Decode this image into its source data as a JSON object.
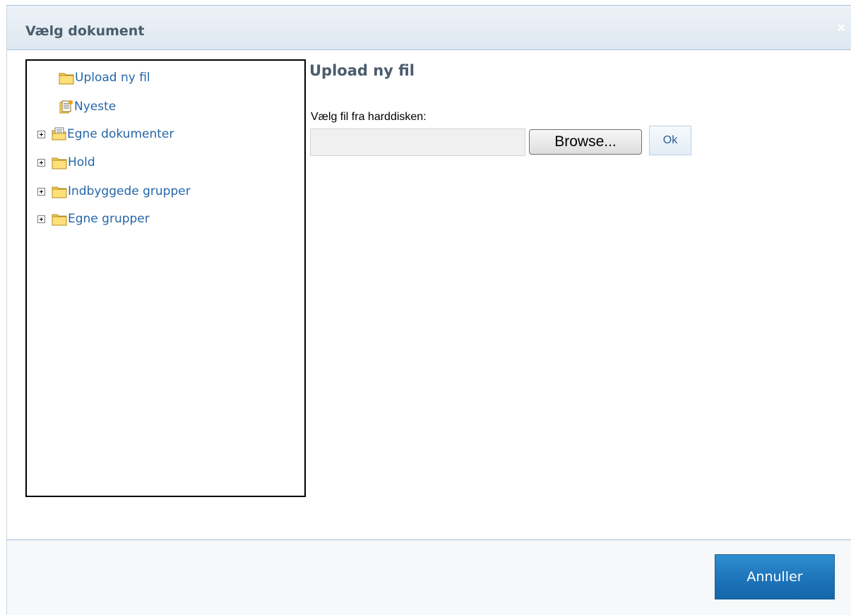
{
  "dialog": {
    "title": "Vælg dokument",
    "close_icon": "close-icon"
  },
  "tree": {
    "items": [
      {
        "label": "Upload ny fil",
        "icon": "folder-icon",
        "expandable": false
      },
      {
        "label": "Nyeste",
        "icon": "document-new-icon",
        "expandable": false
      },
      {
        "label": "Egne dokumenter",
        "icon": "documents-folder-icon",
        "expandable": true
      },
      {
        "label": "Hold",
        "icon": "folder-icon",
        "expandable": true
      },
      {
        "label": "Indbyggede grupper",
        "icon": "folder-icon",
        "expandable": true
      },
      {
        "label": "Egne grupper",
        "icon": "folder-icon",
        "expandable": true
      }
    ]
  },
  "upload": {
    "heading": "Upload ny fil",
    "file_label": "Vælg fil fra harddisken:",
    "file_value": "",
    "browse_label": "Browse...",
    "ok_label": "Ok"
  },
  "footer": {
    "cancel_label": "Annuller"
  },
  "colors": {
    "link": "#2566a8",
    "heading": "#4a5c6d",
    "accent": "#1f76bb",
    "folder": "#f6cf57"
  }
}
